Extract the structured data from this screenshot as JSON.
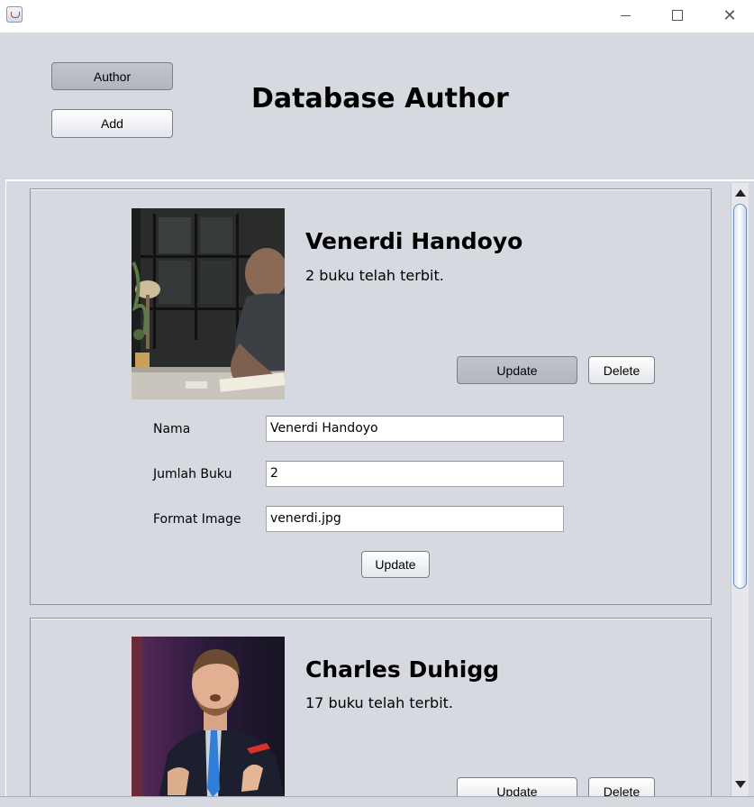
{
  "window": {
    "title": ""
  },
  "nav": {
    "author_label": "Author",
    "add_label": "Add"
  },
  "page": {
    "heading": "Database Author"
  },
  "authors": [
    {
      "name": "Venerdi Handoyo",
      "count_text": "2 buku telah terbit.",
      "update_label": "Update",
      "delete_label": "Delete",
      "form": {
        "nama_label": "Nama",
        "nama_value": "Venerdi Handoyo",
        "jumlah_label": "Jumlah Buku",
        "jumlah_value": "2",
        "format_label": "Format Image",
        "format_value": "venerdi.jpg",
        "submit_label": "Update"
      }
    },
    {
      "name": "Charles Duhigg",
      "count_text": "17 buku telah terbit.",
      "update_label": "Update",
      "delete_label": "Delete"
    }
  ],
  "scrollbar": {
    "position_fraction": 0.0
  }
}
